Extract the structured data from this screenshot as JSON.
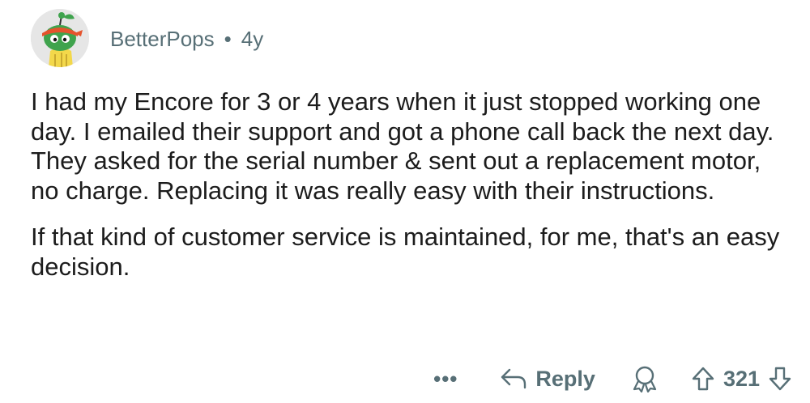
{
  "comment": {
    "username": "BetterPops",
    "separator": "•",
    "age": "4y",
    "paragraphs": [
      "I had my Encore for 3 or 4 years when it just stopped working one day. I emailed their support and got a phone call back the next day. They asked for the serial number & sent out a replacement motor, no charge. Replacing it was really easy with their instructions.",
      "If that kind of customer service is maintained, for me, that's an easy decision."
    ]
  },
  "actions": {
    "more_label": "•••",
    "reply_label": "Reply",
    "score": "321"
  },
  "icons": {
    "avatar": "snoo-avatar",
    "reply": "reply-arrow-icon",
    "award": "award-icon",
    "upvote": "upvote-arrow-icon",
    "downvote": "downvote-arrow-icon"
  },
  "colors": {
    "meta_text": "#576f76",
    "body_text": "#1c1c1c",
    "background": "#ffffff"
  }
}
